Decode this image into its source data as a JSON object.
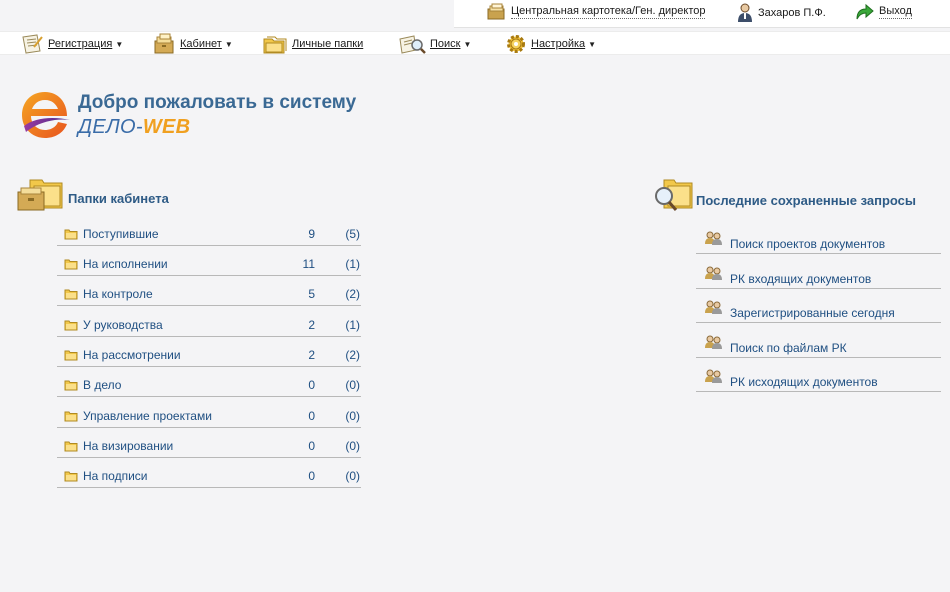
{
  "user_bar": {
    "cabinet_label": "Центральная картотека/Ген. директор",
    "user_name": "Захаров П.Ф.",
    "logout_label": "Выход"
  },
  "menu": {
    "items": [
      {
        "label": "Регистрация",
        "has_dropdown": true,
        "icon": "registration-icon"
      },
      {
        "label": "Кабинет",
        "has_dropdown": true,
        "icon": "cabinet-icon"
      },
      {
        "label": "Личные папки",
        "has_dropdown": false,
        "icon": "personal-folders-icon"
      },
      {
        "label": "Поиск",
        "has_dropdown": true,
        "icon": "search-icon"
      },
      {
        "label": "Настройка",
        "has_dropdown": true,
        "icon": "settings-gear-icon"
      }
    ]
  },
  "logo": {
    "welcome": "Добро пожаловать в систему",
    "product_part1": "ДЕЛО-",
    "product_part2": "WEB"
  },
  "folders": {
    "title": "Папки кабинета",
    "items": [
      {
        "name": "Поступившие",
        "count": "9",
        "new": "(5)"
      },
      {
        "name": "На исполнении",
        "count": "11",
        "new": "(1)"
      },
      {
        "name": "На контроле",
        "count": "5",
        "new": "(2)"
      },
      {
        "name": "У руководства",
        "count": "2",
        "new": "(1)"
      },
      {
        "name": "На рассмотрении",
        "count": "2",
        "new": "(2)"
      },
      {
        "name": "В дело",
        "count": "0",
        "new": "(0)"
      },
      {
        "name": "Управление проектами",
        "count": "0",
        "new": "(0)"
      },
      {
        "name": "На визировании",
        "count": "0",
        "new": "(0)"
      },
      {
        "name": "На подписи",
        "count": "0",
        "new": "(0)"
      }
    ]
  },
  "queries": {
    "title": "Последние сохраненные запросы",
    "items": [
      {
        "name": "Поиск проектов документов"
      },
      {
        "name": "РК входящих документов"
      },
      {
        "name": "Зарегистрированные сегодня"
      },
      {
        "name": "Поиск по файлам РК"
      },
      {
        "name": "РК исходящих документов"
      }
    ]
  },
  "colors": {
    "background": "#f4f4f6",
    "link": "#1f4f82",
    "heading": "#3a6994",
    "accent_orange": "#f0a020"
  }
}
